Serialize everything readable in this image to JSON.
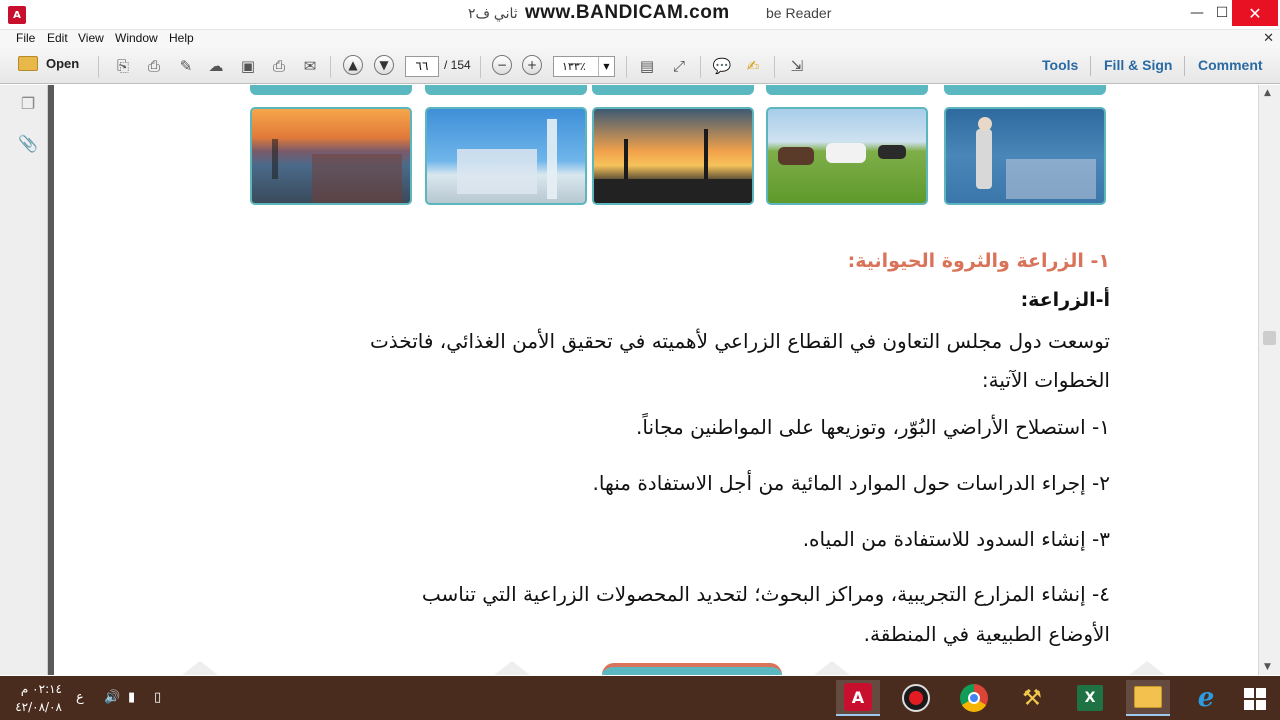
{
  "window": {
    "title": "...ثاني ف٢ - Adobe Reader",
    "title_prefix": "ثاني ف٢",
    "title_suffix": "be Reader",
    "watermark": "www.BANDICAM.com",
    "minimize": "—",
    "maximize": "☐",
    "close": "✕"
  },
  "menu": {
    "items": [
      "File",
      "Edit",
      "View",
      "Window",
      "Help"
    ],
    "close": "✕"
  },
  "toolbar": {
    "open_label": "Open",
    "page_current": "٦٦",
    "page_total": "/ 154",
    "zoom": "١٣٣٪",
    "tools_label": "Tools",
    "fill_sign_label": "Fill & Sign",
    "comment_label": "Comment"
  },
  "content": {
    "heading_main": "١- الزراعة والثروة الحيوانية:",
    "heading_sub": "أ-الزراعة:",
    "para_line1": "توسعت دول مجلس التعاون في القطاع الزراعي لأهميته في تحقيق الأمن الغذائي، فاتخذت",
    "para_line2": "الخطوات الآتية:",
    "step1": "١- استصلاح الأراضي البُوّر، وتوزيعها على المواطنين مجاناً.",
    "step2": "٢- إجراء الدراسات حول الموارد المائية من أجل الاستفادة منها.",
    "step3": "٣- إنشاء السدود للاستفادة من المياه.",
    "step4_line1": "٤- إنشاء المزارع التجريبية، ومراكز البحوث؛ لتحديد المحصولات الزراعية التي تناسب",
    "step4_line2": "الأوضاع الطبيعية في المنطقة."
  },
  "taskbar": {
    "time": "٠٢:١٤ م",
    "date": "٤٢/٠٨/٠٨",
    "lang": "ع"
  },
  "colors": {
    "heading_accent": "#d9745a",
    "frame_teal": "#5cb6bd",
    "link_blue": "#2a6aa3",
    "taskbar_bg": "#4a2c1e"
  }
}
